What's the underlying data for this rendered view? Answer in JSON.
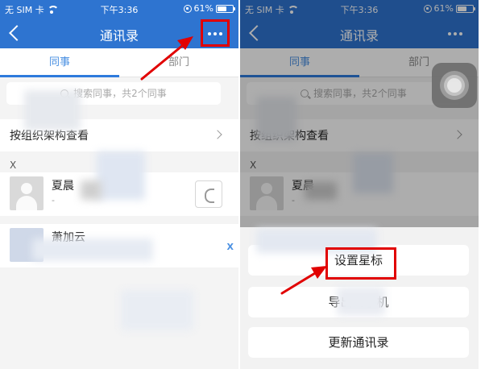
{
  "colors": {
    "header": "#2e74d0",
    "highlight": "#e10000",
    "tab_active": "#4a90e2",
    "overlay": "rgba(0,0,0,0.32)"
  },
  "status_bar": {
    "carrier": "无 SIM 卡",
    "time": "下午3:36",
    "battery": "61%",
    "battery_level": 0.61,
    "icons": [
      "wifi-icon",
      "rotation-lock-icon",
      "battery-icon"
    ]
  },
  "nav": {
    "title": "通讯录",
    "back_icon": "chevron-left-icon",
    "more_icon": "more-dots-icon"
  },
  "tabs": [
    {
      "label": "同事",
      "active": true
    },
    {
      "label": "部门",
      "active": false
    }
  ],
  "search": {
    "placeholder": "搜索同事，共2个同事"
  },
  "org_link": {
    "label": "按组织架构查看",
    "icon": "chevron-right-icon"
  },
  "section_letter": "X",
  "contacts": [
    {
      "name": "夏晨",
      "subtitle": "-",
      "action_icon": "phone-icon"
    },
    {
      "name": "萧加云",
      "subtitle": "",
      "trailing": "X"
    }
  ],
  "action_sheet": {
    "items": [
      "设置星标",
      "导出到手机",
      "更新通讯录"
    ]
  }
}
